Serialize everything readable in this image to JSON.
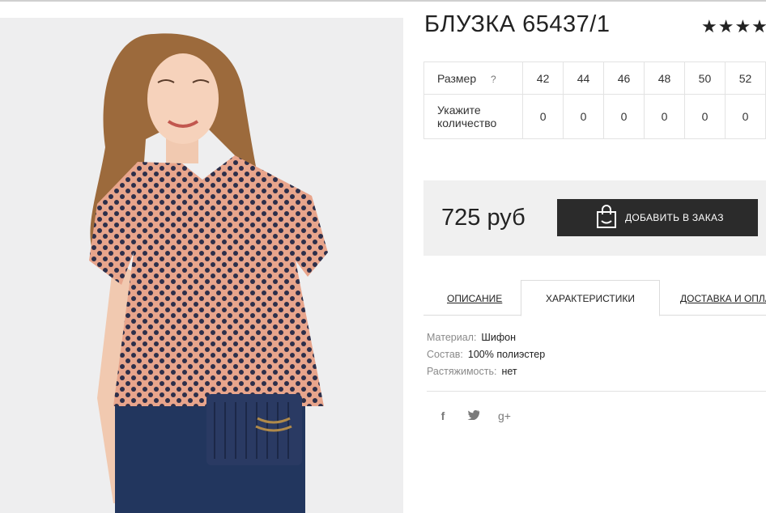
{
  "product": {
    "title": "БЛУЗКА 65437/1",
    "rating_stars": "★★★★★"
  },
  "size_table": {
    "size_label": "Размер",
    "help": "?",
    "sizes": [
      "42",
      "44",
      "46",
      "48",
      "50",
      "52"
    ],
    "qty_label_line1": "Укажите",
    "qty_label_line2": "количество",
    "quantities": [
      "0",
      "0",
      "0",
      "0",
      "0",
      "0"
    ]
  },
  "purchase": {
    "price": "725 руб",
    "add_button": "ДОБАВИТЬ В ЗАКАЗ"
  },
  "tabs": {
    "description": "ОПИСАНИЕ",
    "characteristics": "ХАРАКТЕРИСТИКИ",
    "delivery": "ДОСТАВКА И ОПЛАТА",
    "active": "characteristics"
  },
  "characteristics": [
    {
      "key": "Материал:",
      "value": "Шифон"
    },
    {
      "key": "Состав:",
      "value": "100% полиэстер"
    },
    {
      "key": "Растяжимость:",
      "value": "нет"
    }
  ],
  "social": {
    "facebook": "f",
    "twitter": "twitter-icon",
    "google_plus": "g+"
  },
  "colors": {
    "button_bg": "#2b2b2b",
    "price_box_bg": "#f0f0f0",
    "photo_bg": "#eeeeef"
  }
}
